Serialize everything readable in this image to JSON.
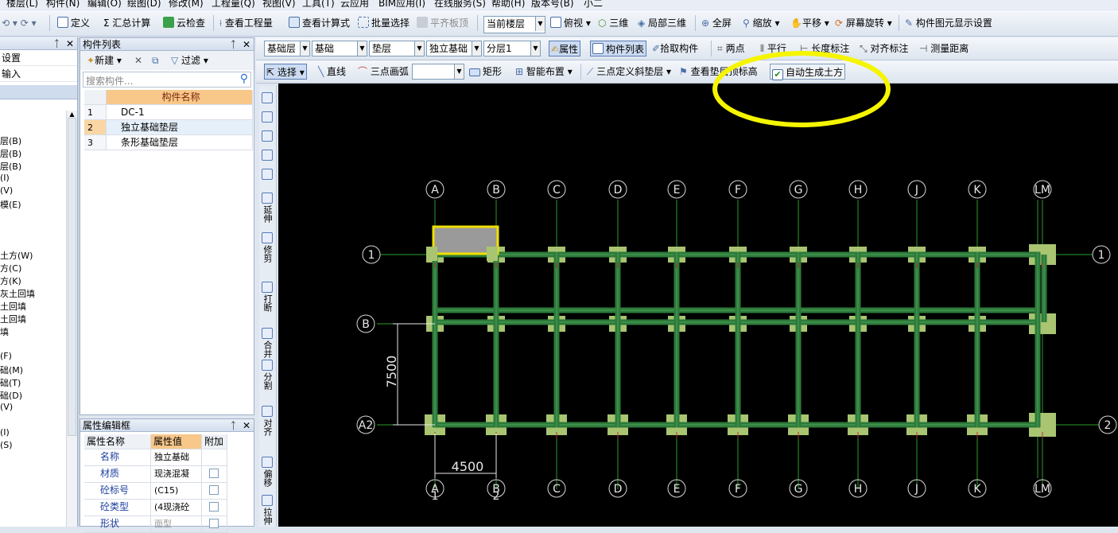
{
  "menubar": [
    "楼层(L)",
    "构件(N)",
    "编辑(O)",
    "绘图(D)",
    "修改(M)",
    "工程量(Q)",
    "视图(V)",
    "工具(T)",
    "云应用",
    "BIM应用(I)",
    "在线服务(S)",
    "帮助(H)",
    "版本号(B)",
    "小二"
  ],
  "toolbar1": {
    "define": "定义",
    "sum_calc": "汇总计算",
    "cloud_check": "云检查",
    "view_quantity": "查看工程量",
    "view_formula": "查看计算式",
    "batch_select": "批量选择",
    "align_slab": "平齐板顶",
    "floor_select": "当前楼层",
    "top_view": "俯视",
    "three_d": "三维",
    "local_3d": "局部三维",
    "full_screen": "全屏",
    "zoom": "缩放",
    "pan": "平移",
    "rotate_screen": "屏幕旋转",
    "display_settings": "构件图元显示设置"
  },
  "toolbar2": {
    "layer": "基础层",
    "category": "基础",
    "type": "垫层",
    "component": "独立基础",
    "sublayer": "分层1",
    "properties": "属性",
    "component_list": "构件列表",
    "pick_component": "拾取构件",
    "two_points": "两点",
    "parallel": "平行",
    "length_mark": "长度标注",
    "align_mark": "对齐标注",
    "measure": "测量距离"
  },
  "toolbar3": {
    "select": "选择",
    "line": "直线",
    "arc": "三点画弧",
    "rect": "矩形",
    "smart_layout": "智能布置",
    "three_point_slope": "三点定义斜垫层",
    "view_top_elev": "查看垫层顶标高",
    "auto_earthwork": "自动生成土方"
  },
  "left_nav": {
    "top_items": [
      "设置",
      "输入"
    ],
    "items": [
      "层(B)",
      "层(B)",
      "层(B)",
      "(I)",
      "(V)",
      "模(E)",
      "土方(W)",
      "方(C)",
      "方(K)",
      "灰土回填",
      "土回填",
      "土回填",
      "填",
      "(F)",
      "础(M)",
      "础(T)",
      "础(D)",
      "(V)",
      "(I)",
      "(S)"
    ]
  },
  "component_list": {
    "title": "构件列表",
    "new_btn": "新建",
    "filter_btn": "过滤",
    "search_placeholder": "搜索构件...",
    "header": "构件名称",
    "rows": [
      {
        "num": "1",
        "name": "DC-1"
      },
      {
        "num": "2",
        "name": "独立基础垫层"
      },
      {
        "num": "3",
        "name": "条形基础垫层"
      }
    ]
  },
  "property_editor": {
    "title": "属性编辑框",
    "headers": [
      "属性名称",
      "属性值",
      "附加"
    ],
    "rows": [
      {
        "name": "名称",
        "value": "独立基础"
      },
      {
        "name": "材质",
        "value": "现浇混凝"
      },
      {
        "name": "砼标号",
        "value": "(C15)"
      },
      {
        "name": "砼类型",
        "value": "(4现浇砼"
      },
      {
        "name": "形状",
        "value": "面型"
      }
    ]
  },
  "vertical_toolbar": [
    "延伸",
    "修剪",
    "打断",
    "合并",
    "分割",
    "对齐",
    "偏移",
    "拉伸"
  ],
  "drawing": {
    "col_axes": [
      "A",
      "B",
      "C",
      "D",
      "E",
      "F",
      "G",
      "H",
      "J",
      "K",
      "LM"
    ],
    "row_axes_left": [
      "1",
      "B",
      "A2"
    ],
    "row_axes_right": [
      "1",
      "2"
    ],
    "bottom_axes": [
      "A",
      "B",
      "C",
      "D",
      "E",
      "F",
      "G",
      "H",
      "J",
      "K",
      "LM"
    ],
    "bottom_sub": [
      "1",
      "2"
    ],
    "dim_vertical": "7500",
    "dim_horizontal": "4500"
  }
}
